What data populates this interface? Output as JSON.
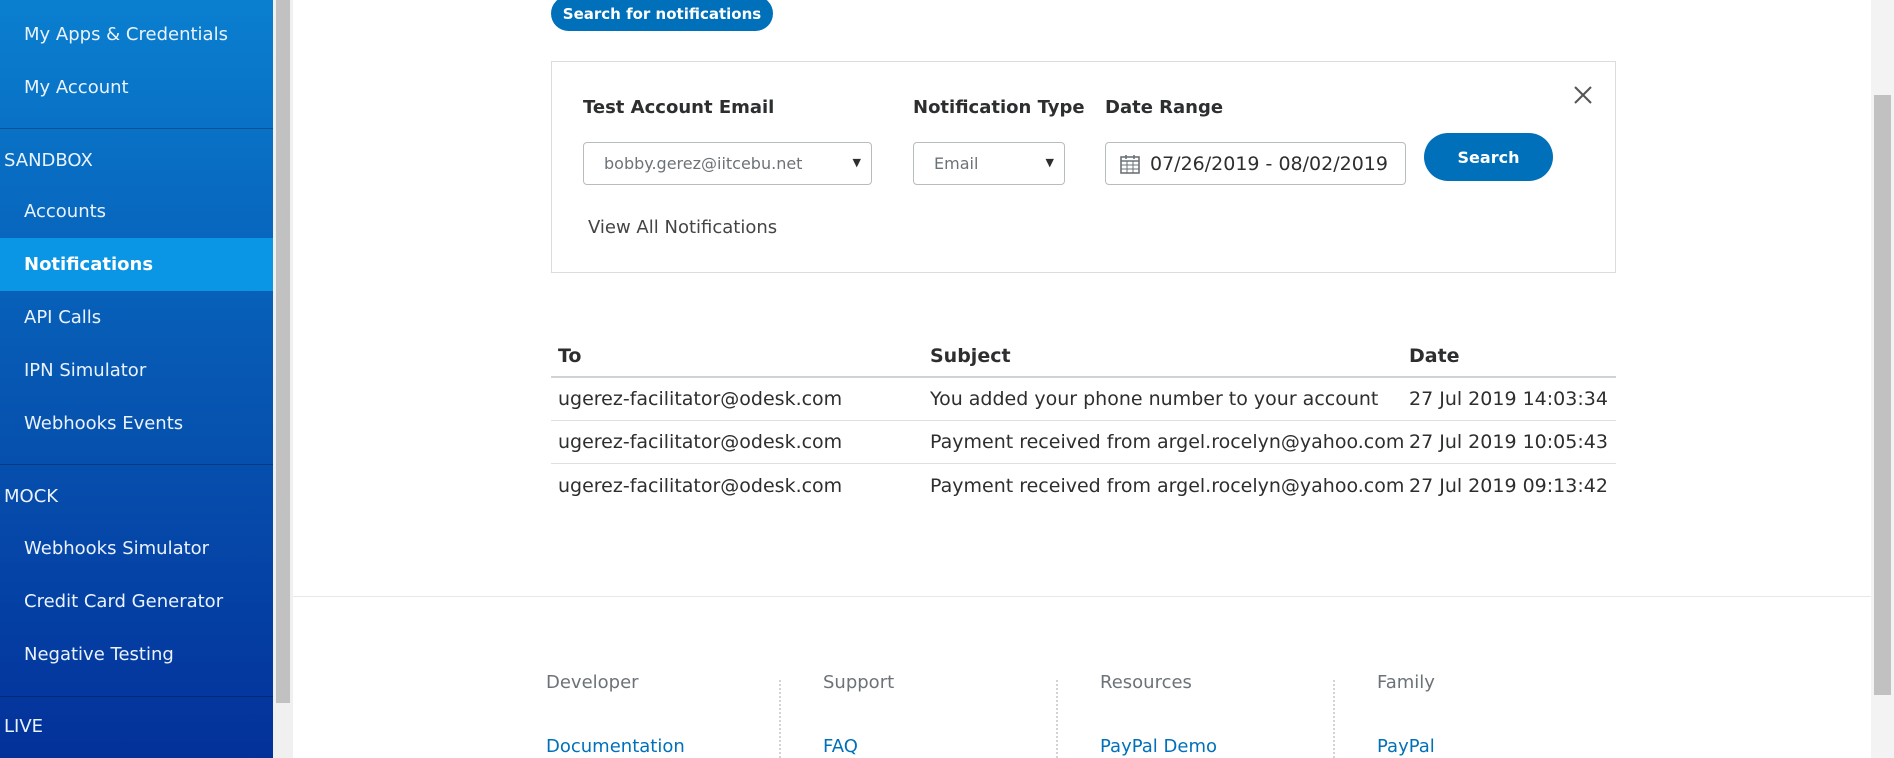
{
  "sidebar": {
    "top_items": [
      {
        "label": "My Apps & Credentials"
      },
      {
        "label": "My Account"
      }
    ],
    "sandbox_label": "SANDBOX",
    "sandbox_items": [
      {
        "label": "Accounts"
      },
      {
        "label": "Notifications",
        "active": true
      },
      {
        "label": "API Calls"
      },
      {
        "label": "IPN Simulator"
      },
      {
        "label": "Webhooks Events"
      }
    ],
    "mock_label": "MOCK",
    "mock_items": [
      {
        "label": "Webhooks Simulator"
      },
      {
        "label": "Credit Card Generator"
      },
      {
        "label": "Negative Testing"
      }
    ],
    "live_label": "LIVE"
  },
  "header": {
    "search_button": "Search for notifications"
  },
  "search_panel": {
    "email_label": "Test Account Email",
    "email_value": "bobby.gerez@iitcebu.net",
    "type_label": "Notification Type",
    "type_value": "Email",
    "date_label": "Date Range",
    "date_value": "07/26/2019 - 08/02/2019",
    "search_label": "Search",
    "view_all": "View All Notifications"
  },
  "table": {
    "columns": [
      "To",
      "Subject",
      "Date"
    ],
    "rows": [
      [
        "ugerez-facilitator@odesk.com",
        "You added your phone number to your account",
        "27 Jul 2019 14:03:34"
      ],
      [
        "ugerez-facilitator@odesk.com",
        "Payment received from argel.rocelyn@yahoo.com",
        "27 Jul 2019 10:05:43"
      ],
      [
        "ugerez-facilitator@odesk.com",
        "Payment received from argel.rocelyn@yahoo.com",
        "27 Jul 2019 09:13:42"
      ]
    ]
  },
  "footer": {
    "columns": [
      {
        "heading": "Developer",
        "link": "Documentation"
      },
      {
        "heading": "Support",
        "link": "FAQ"
      },
      {
        "heading": "Resources",
        "link": "PayPal Demo"
      },
      {
        "heading": "Family",
        "link": "PayPal"
      }
    ]
  },
  "colors": {
    "brand_blue": "#0070ba",
    "sidebar_active": "#0a96e4"
  }
}
